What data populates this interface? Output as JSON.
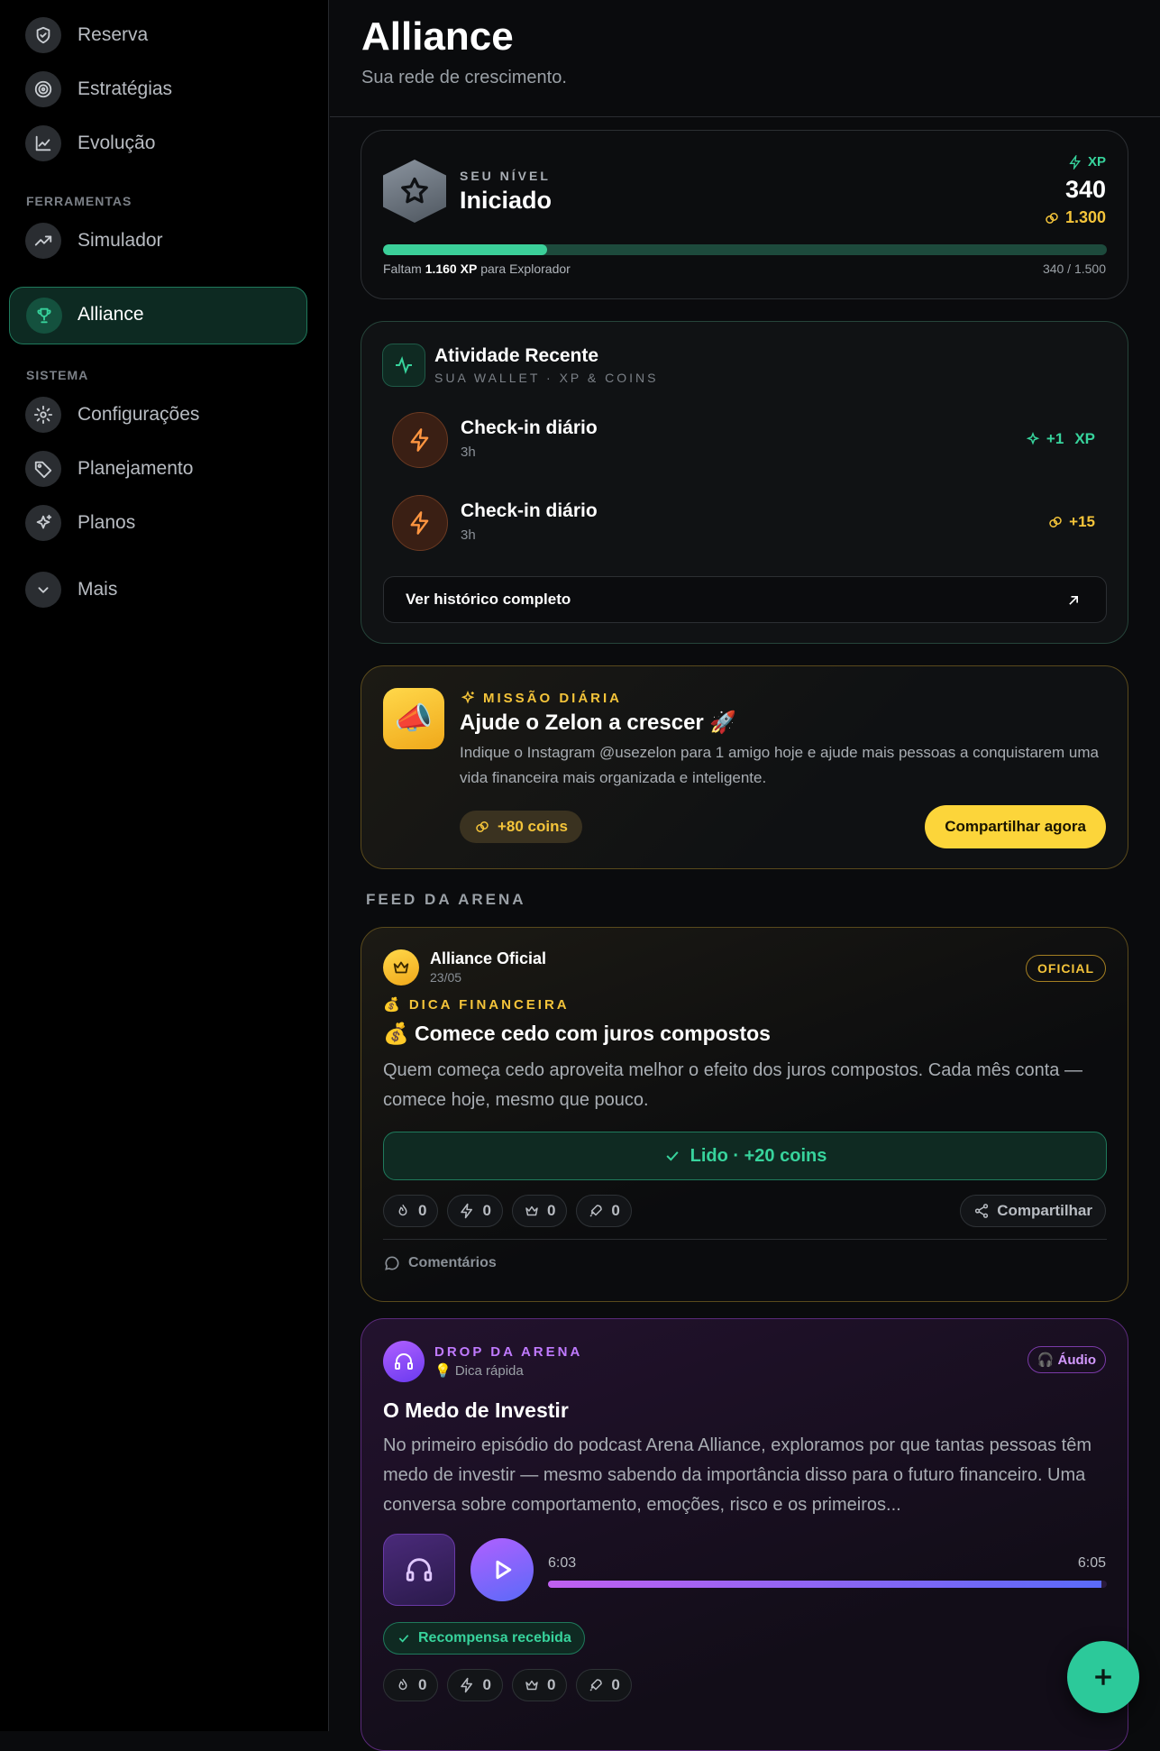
{
  "sidebar": {
    "items_top": [
      {
        "label": "Reserva",
        "icon": "shield-icon"
      },
      {
        "label": "Estratégias",
        "icon": "target-icon"
      },
      {
        "label": "Evolução",
        "icon": "line-chart-icon"
      }
    ],
    "section_tools": "FERRAMENTAS",
    "simulador": "Simulador",
    "active": "Alliance",
    "section_system": "SISTEMA",
    "items_system": [
      {
        "label": "Configurações",
        "icon": "gear-icon"
      },
      {
        "label": "Planejamento",
        "icon": "tag-icon"
      },
      {
        "label": "Planos",
        "icon": "sparkles-icon"
      }
    ],
    "more": "Mais"
  },
  "header": {
    "title": "Alliance",
    "subtitle": "Sua rede de crescimento."
  },
  "level": {
    "caption": "SEU NÍVEL",
    "name": "Iniciado",
    "xp_label": "XP",
    "xp": "340",
    "coins": "1.300",
    "progress_fraction": 0.227,
    "remaining_prefix": "Faltam",
    "remaining_amount": "1.160 XP",
    "remaining_suffix": "para Explorador",
    "progress_text": "340 / 1.500"
  },
  "activity": {
    "title": "Atividade Recente",
    "subtitle": "SUA WALLET · XP & COINS",
    "rows": [
      {
        "title": "Check-in diário",
        "time": "3h",
        "reward": "+1",
        "unit": "XP"
      },
      {
        "title": "Check-in diário",
        "time": "3h",
        "reward": "+15"
      }
    ],
    "history_button": "Ver histórico completo"
  },
  "mission": {
    "tag": "MISSÃO DIÁRIA",
    "title": "Ajude o Zelon a crescer 🚀",
    "description": "Indique o Instagram @usezelon para 1 amigo hoje e ajude mais pessoas a conquistarem uma vida financeira mais organizada e inteligente.",
    "reward": "+80 coins",
    "button": "Compartilhar agora",
    "icon_glyph": "📣"
  },
  "feed": {
    "label": "FEED DA ARENA",
    "post1": {
      "author": "Alliance Oficial",
      "date": "23/05",
      "badge": "OFICIAL",
      "tag": "💰 DICA FINANCEIRA",
      "title": "💰 Comece cedo com juros compostos",
      "text": "Quem começa cedo aproveita melhor o efeito dos juros compostos. Cada mês conta — comece hoje, mesmo que pouco.",
      "read_button": "Lido · +20 coins",
      "reactions": [
        "0",
        "0",
        "0",
        "0"
      ],
      "share": "Compartilhar",
      "comments": "Comentários"
    },
    "post2": {
      "tag": "DROP DA ARENA",
      "subtag": "💡 Dica rápida",
      "badge": "🎧 Áudio",
      "title": "O Medo de Investir",
      "text": "No primeiro episódio do podcast Arena Alliance, exploramos por que tantas pessoas têm medo de investir — mesmo sabendo da importância disso para o futuro financeiro. Uma conversa sobre comportamento, emoções, risco e os primeiros...",
      "time_current": "6:03",
      "time_total": "6:05",
      "progress_fraction": 0.99,
      "reward": "Recompensa recebida",
      "reactions": [
        "0",
        "0",
        "0",
        "0"
      ]
    }
  },
  "colors": {
    "accent_green": "#37d39c",
    "gold": "#f4c43a",
    "purple": "#c07aff"
  }
}
